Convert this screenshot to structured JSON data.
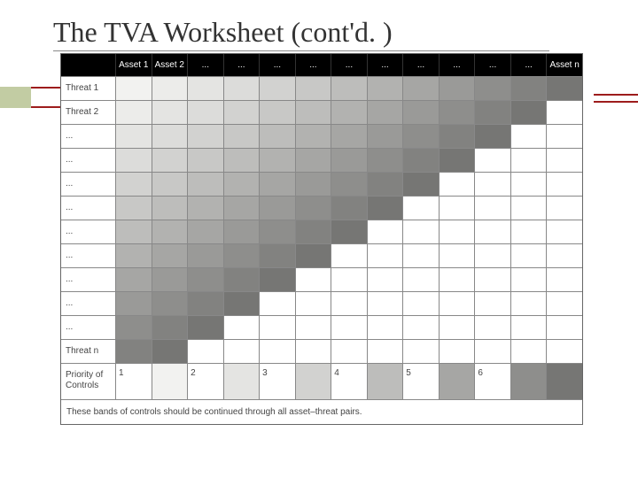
{
  "title": "The TVA Worksheet (cont'd. )",
  "header": {
    "blank": "",
    "cols": [
      "Asset 1",
      "Asset 2",
      "...",
      "...",
      "...",
      "...",
      "...",
      "...",
      "...",
      "...",
      "...",
      "...",
      "Asset n"
    ]
  },
  "rows": [
    {
      "label": "Threat 1",
      "shades": [
        0,
        1,
        2,
        3,
        4,
        5,
        6,
        7,
        8,
        9,
        10,
        11,
        12
      ]
    },
    {
      "label": "Threat 2",
      "shades": [
        1,
        2,
        3,
        4,
        5,
        6,
        7,
        8,
        9,
        10,
        11,
        12,
        null
      ]
    },
    {
      "label": "...",
      "shades": [
        2,
        3,
        4,
        5,
        6,
        7,
        8,
        9,
        10,
        11,
        12,
        null,
        null
      ]
    },
    {
      "label": "...",
      "shades": [
        3,
        4,
        5,
        6,
        7,
        8,
        9,
        10,
        11,
        12,
        null,
        null,
        null
      ]
    },
    {
      "label": "...",
      "shades": [
        4,
        5,
        6,
        7,
        8,
        9,
        10,
        11,
        12,
        null,
        null,
        null,
        null
      ]
    },
    {
      "label": "...",
      "shades": [
        5,
        6,
        7,
        8,
        9,
        10,
        11,
        12,
        null,
        null,
        null,
        null,
        null
      ]
    },
    {
      "label": "...",
      "shades": [
        6,
        7,
        8,
        9,
        10,
        11,
        12,
        null,
        null,
        null,
        null,
        null,
        null
      ]
    },
    {
      "label": "...",
      "shades": [
        7,
        8,
        9,
        10,
        11,
        12,
        null,
        null,
        null,
        null,
        null,
        null,
        null
      ]
    },
    {
      "label": "...",
      "shades": [
        8,
        9,
        10,
        11,
        12,
        null,
        null,
        null,
        null,
        null,
        null,
        null,
        null
      ]
    },
    {
      "label": "...",
      "shades": [
        9,
        10,
        11,
        12,
        null,
        null,
        null,
        null,
        null,
        null,
        null,
        null,
        null
      ]
    },
    {
      "label": "...",
      "shades": [
        10,
        11,
        12,
        null,
        null,
        null,
        null,
        null,
        null,
        null,
        null,
        null,
        null
      ]
    },
    {
      "label": "Threat n",
      "shades": [
        11,
        12,
        null,
        null,
        null,
        null,
        null,
        null,
        null,
        null,
        null,
        null,
        null
      ]
    }
  ],
  "priority_row": {
    "label": "Priority of Controls",
    "cells": [
      "1",
      "",
      "2",
      "",
      "3",
      "",
      "4",
      "",
      "5",
      "",
      "6",
      "",
      ""
    ],
    "shades": [
      null,
      0,
      null,
      2,
      null,
      4,
      null,
      6,
      null,
      8,
      null,
      10,
      12
    ]
  },
  "footnote": "These bands of controls should be continued through all asset–threat pairs.",
  "shade_scale": {
    "0": "#f2f2f0",
    "1": "#ececea",
    "2": "#e4e4e2",
    "3": "#dcdcda",
    "4": "#d2d2d0",
    "5": "#c8c8c6",
    "6": "#bdbdbb",
    "7": "#b2b2b0",
    "8": "#a6a6a4",
    "9": "#9a9a98",
    "10": "#8e8e8c",
    "11": "#828280",
    "12": "#767674"
  }
}
